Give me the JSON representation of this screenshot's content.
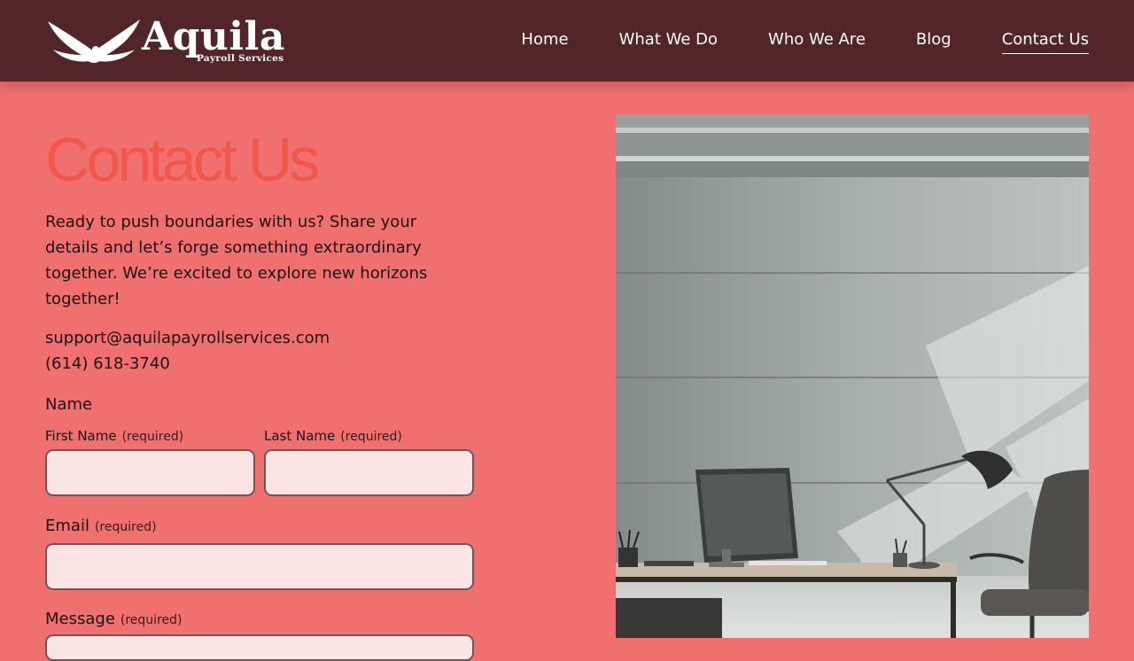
{
  "brand": {
    "name": "Aquila",
    "subtitle": "Payroll Services"
  },
  "nav": {
    "items": [
      {
        "label": "Home"
      },
      {
        "label": "What We Do"
      },
      {
        "label": "Who We Are"
      },
      {
        "label": "Blog"
      },
      {
        "label": "Contact Us",
        "active": true
      }
    ]
  },
  "main": {
    "title": "Contact Us",
    "intro": "Ready to push boundaries with us? Share your details and let’s forge something extraordinary together. We’re excited to explore new horizons together!",
    "email": "support@aquilapayrollservices.com",
    "phone": "(614) 618-3740"
  },
  "form": {
    "name_label": "Name",
    "first_name": {
      "label": "First Name",
      "required": "(required)",
      "value": ""
    },
    "last_name": {
      "label": "Last Name",
      "required": "(required)",
      "value": ""
    },
    "email": {
      "label": "Email",
      "required": "(required)",
      "value": ""
    },
    "message": {
      "label": "Message",
      "required": "(required)"
    }
  },
  "colors": {
    "header_bg": "#522628",
    "page_bg": "#f07070",
    "title": "#f2584a",
    "input_bg": "#fde4e4"
  },
  "icons": {
    "logo": "eagle-logo-icon",
    "photo": "office-desk-image"
  }
}
